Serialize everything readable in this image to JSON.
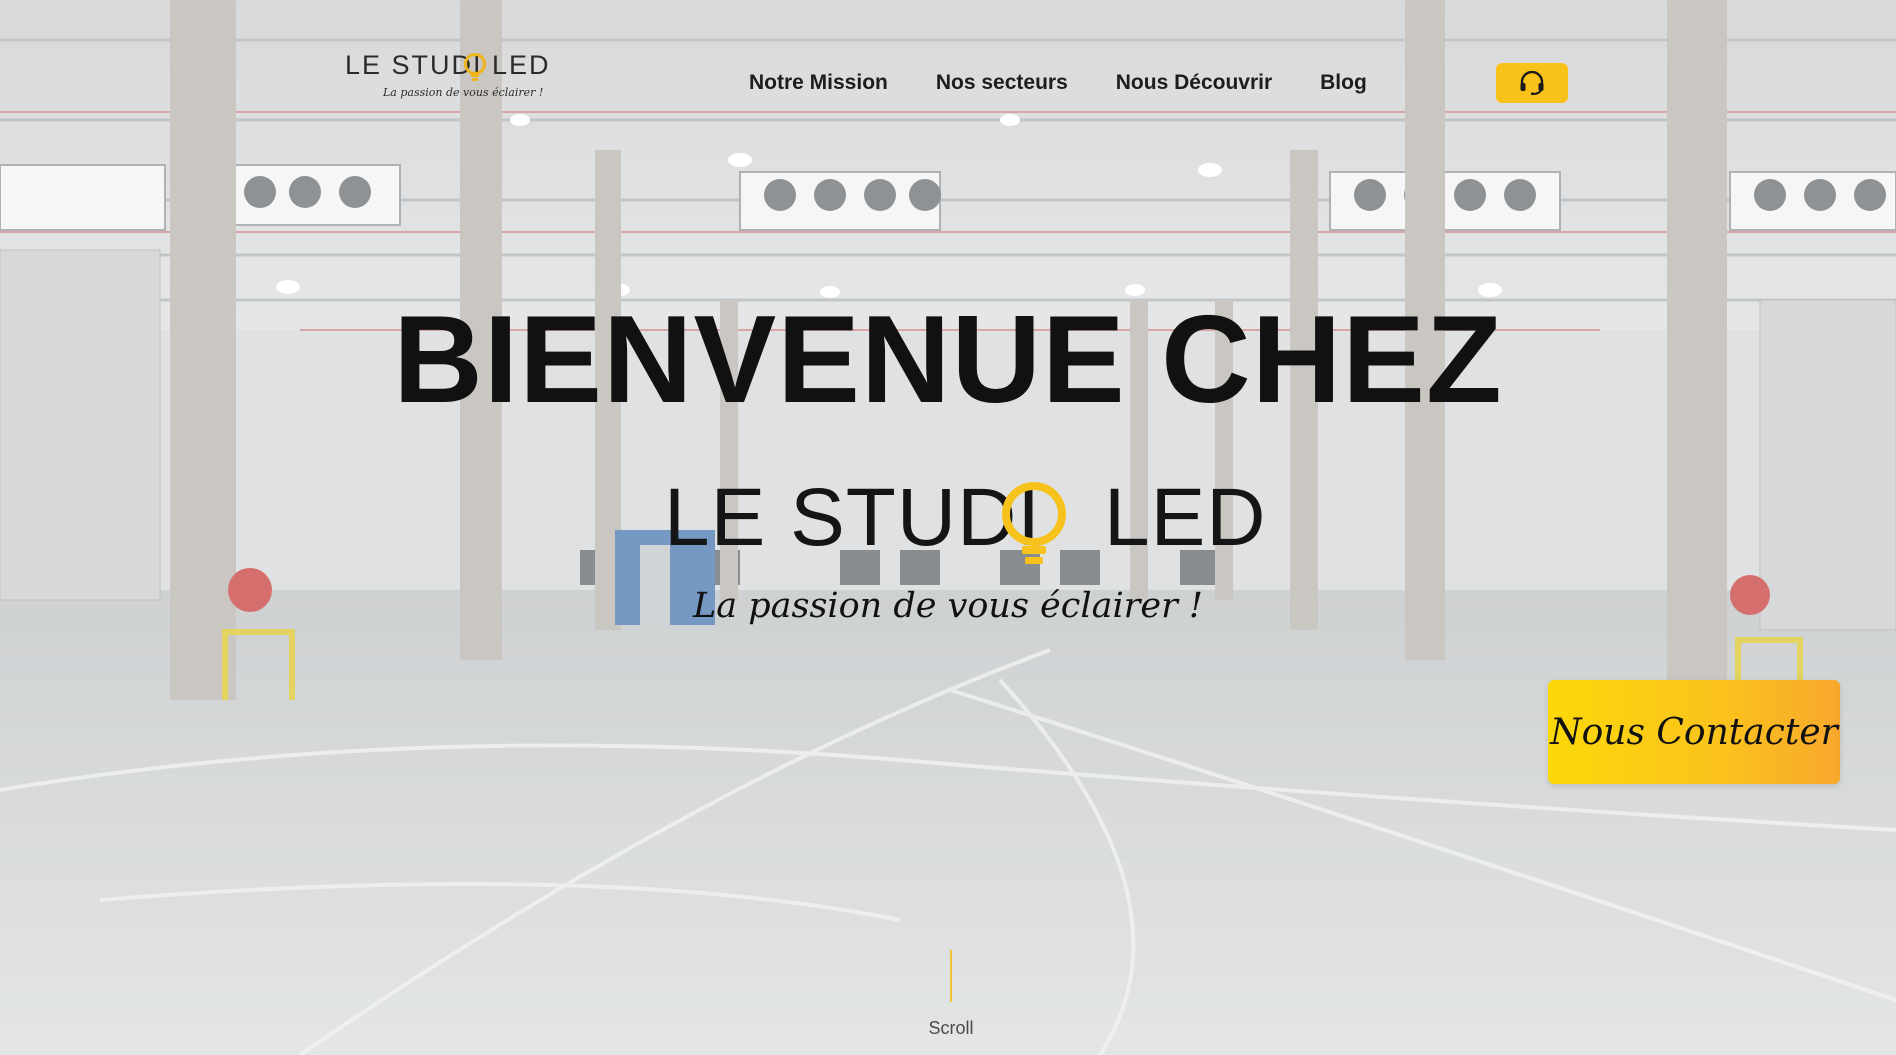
{
  "header": {
    "logo": {
      "left_text": "LE STUDI",
      "right_text": "LED",
      "tagline": "La passion de vous éclairer !"
    },
    "nav": [
      {
        "label": "Notre Mission"
      },
      {
        "label": "Nos secteurs"
      },
      {
        "label": "Nous Découvrir"
      },
      {
        "label": "Blog"
      }
    ],
    "support_icon": "headset-icon"
  },
  "hero": {
    "title": "BIENVENUE CHEZ",
    "brand_left": "LE STUDI",
    "brand_right": "LED",
    "tagline": "La passion de vous éclairer !",
    "cta_label": "Nous Contacter"
  },
  "scroll": {
    "label": "Scroll"
  },
  "colors": {
    "accent": "#f8c21a",
    "cta_start": "#fcd90a",
    "cta_end": "#f7a82c",
    "text": "#111111"
  }
}
